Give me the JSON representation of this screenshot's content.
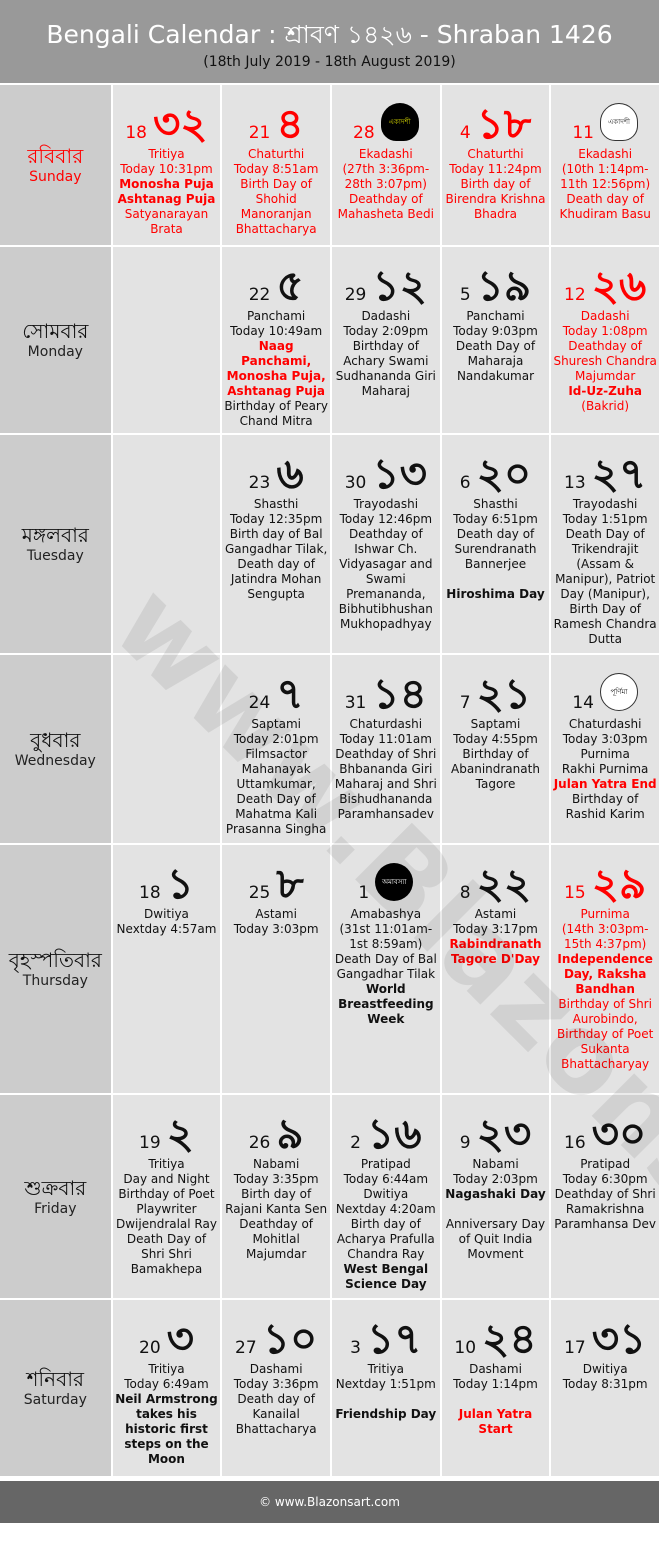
{
  "header": {
    "title": "Bengali Calendar : শ্রাবণ ১৪২৬ - Shraban 1426",
    "subtitle": "(18th July 2019 - 18th August 2019)"
  },
  "watermark": "www.Blazonsart.com",
  "footer": {
    "text": "© www.Blazonsart.com"
  },
  "colors": {
    "header_bg": "#999999",
    "day_bg": "#cccccc",
    "cell_bg": "#e3e3e3",
    "holiday_red": "#ff0000",
    "footer_bg": "#666666"
  },
  "rows": [
    {
      "day_bn": "রবিবার",
      "day_en": "Sunday",
      "holiday": true,
      "cells": [
        {
          "eng": "18",
          "bng": "৩২",
          "red": true,
          "lines": [
            {
              "t": "Tritiya"
            },
            {
              "t": "Today 10:31pm"
            },
            {
              "t": "Monosha Puja",
              "b": true
            },
            {
              "t": "Ashtanag Puja",
              "b": true
            },
            {
              "t": "Satyanarayan Brata"
            }
          ]
        },
        {
          "eng": "21",
          "bng": "৪",
          "red": true,
          "lines": [
            {
              "t": "Chaturthi"
            },
            {
              "t": "Today 8:51am"
            },
            {
              "t": "Birth Day of Shohid Manoranjan Bhattacharya"
            }
          ]
        },
        {
          "eng": "28",
          "moon": "crescent-dark",
          "moon_label": "একাদশী",
          "red": true,
          "lines": [
            {
              "t": "Ekadashi"
            },
            {
              "t": "(27th 3:36pm-28th 3:07pm)"
            },
            {
              "t": "Deathday of Mahasheta Bedi"
            }
          ]
        },
        {
          "eng": "4",
          "bng": "১৮",
          "red": true,
          "lines": [
            {
              "t": "Chaturthi"
            },
            {
              "t": "Today 11:24pm"
            },
            {
              "t": "Birth day of Birendra Krishna Bhadra"
            }
          ]
        },
        {
          "eng": "11",
          "moon": "crescent-light",
          "moon_label": "একাদশী",
          "red": true,
          "lines": [
            {
              "t": "Ekadashi"
            },
            {
              "t": "(10th 1:14pm-11th 12:56pm)"
            },
            {
              "t": "Death day of Khudiram Basu"
            }
          ]
        }
      ]
    },
    {
      "day_bn": "সোমবার",
      "day_en": "Monday",
      "cells": [
        null,
        {
          "eng": "22",
          "bng": "৫",
          "lines": [
            {
              "t": "Panchami"
            },
            {
              "t": "Today 10:49am"
            },
            {
              "t": "Naag Panchami, Monosha Puja, Ashtanag Puja",
              "b": true,
              "r": true
            },
            {
              "t": "Birthday of Peary Chand Mitra"
            }
          ]
        },
        {
          "eng": "29",
          "bng": "১২",
          "lines": [
            {
              "t": "Dadashi"
            },
            {
              "t": "Today 2:09pm"
            },
            {
              "t": "Birthday of Achary Swami Sudhananda Giri Maharaj"
            }
          ]
        },
        {
          "eng": "5",
          "bng": "১৯",
          "lines": [
            {
              "t": "Panchami"
            },
            {
              "t": "Today 9:03pm"
            },
            {
              "t": "Death Day of Maharaja Nandakumar"
            }
          ]
        },
        {
          "eng": "12",
          "bng": "২৬",
          "red": true,
          "lines": [
            {
              "t": "Dadashi"
            },
            {
              "t": "Today 1:08pm"
            },
            {
              "t": "Deathday of Shuresh Chandra Majumdar"
            },
            {
              "t": "Id-Uz-Zuha",
              "b": true
            },
            {
              "t": "(Bakrid)"
            }
          ]
        }
      ]
    },
    {
      "day_bn": "মঙ্গলবার",
      "day_en": "Tuesday",
      "cells": [
        null,
        {
          "eng": "23",
          "bng": "৬",
          "lines": [
            {
              "t": "Shasthi"
            },
            {
              "t": "Today 12:35pm"
            },
            {
              "t": "Birth day of Bal Gangadhar Tilak, Death day of Jatindra Mohan Sengupta"
            }
          ]
        },
        {
          "eng": "30",
          "bng": "১৩",
          "lines": [
            {
              "t": "Trayodashi"
            },
            {
              "t": "Today 12:46pm"
            },
            {
              "t": "Deathday of Ishwar Ch. Vidyasagar and Swami Premananda, Bibhutibhushan Mukhopadhyay"
            }
          ]
        },
        {
          "eng": "6",
          "bng": "২০",
          "lines": [
            {
              "t": "Shasthi"
            },
            {
              "t": "Today 6:51pm"
            },
            {
              "t": "Death day of Surendranath Bannerjee"
            },
            {
              "gap": true
            },
            {
              "t": "Hiroshima Day",
              "b": true
            }
          ]
        },
        {
          "eng": "13",
          "bng": "২৭",
          "lines": [
            {
              "t": "Trayodashi"
            },
            {
              "t": "Today 1:51pm"
            },
            {
              "t": "Death Day of Trikendrajit (Assam & Manipur), Patriot Day (Manipur), Birth Day of Ramesh Chandra Dutta"
            }
          ]
        }
      ]
    },
    {
      "day_bn": "বুধবার",
      "day_en": "Wednesday",
      "cells": [
        null,
        {
          "eng": "24",
          "bng": "৭",
          "lines": [
            {
              "t": "Saptami"
            },
            {
              "t": "Today 2:01pm"
            },
            {
              "t": "Filmsactor Mahanayak Uttamkumar, Death Day of Mahatma Kali Prasanna Singha"
            }
          ]
        },
        {
          "eng": "31",
          "bng": "১৪",
          "lines": [
            {
              "t": "Chaturdashi"
            },
            {
              "t": "Today 11:01am"
            },
            {
              "t": "Deathday of Shri Bhbananda Giri Maharaj and Shri Bishudhananda Paramhansadev"
            }
          ]
        },
        {
          "eng": "7",
          "bng": "২১",
          "lines": [
            {
              "t": "Saptami"
            },
            {
              "t": "Today 4:55pm"
            },
            {
              "t": "Birthday of Abanindranath Tagore"
            }
          ]
        },
        {
          "eng": "14",
          "moon": "full",
          "moon_label": "পূর্ণিমা",
          "lines": [
            {
              "t": "Chaturdashi"
            },
            {
              "t": "Today 3:03pm"
            },
            {
              "t": "Purnima"
            },
            {
              "t": "Rakhi Purnima"
            },
            {
              "t": "Julan Yatra End",
              "b": true,
              "r": true
            },
            {
              "t": "Birthday of Rashid Karim"
            }
          ]
        }
      ]
    },
    {
      "day_bn": "বৃহস্পতিবার",
      "day_en": "Thursday",
      "cells": [
        {
          "eng": "18",
          "bng": "১",
          "lines": [
            {
              "t": "Dwitiya"
            },
            {
              "t": "Nextday 4:57am"
            }
          ]
        },
        {
          "eng": "25",
          "bng": "৮",
          "lines": [
            {
              "t": "Astami"
            },
            {
              "t": "Today 3:03pm"
            }
          ]
        },
        {
          "eng": "1",
          "moon": "new",
          "moon_label": "অমাবস্যা",
          "lines": [
            {
              "t": "Amabashya"
            },
            {
              "t": "(31st 11:01am-1st 8:59am)"
            },
            {
              "t": "Death Day of Bal Gangadhar Tilak"
            },
            {
              "t": "World Breastfeeding Week",
              "b": true
            }
          ]
        },
        {
          "eng": "8",
          "bng": "২২",
          "lines": [
            {
              "t": "Astami"
            },
            {
              "t": "Today 3:17pm"
            },
            {
              "t": "Rabindranath Tagore D'Day",
              "b": true,
              "r": true
            }
          ]
        },
        {
          "eng": "15",
          "bng": "২৯",
          "red": true,
          "lines": [
            {
              "t": "Purnima"
            },
            {
              "t": "(14th 3:03pm-15th 4:37pm)"
            },
            {
              "t": "Independence Day, Raksha Bandhan",
              "b": true
            },
            {
              "t": "Birthday of Shri Aurobindo, Birthday of Poet Sukanta Bhattacharyay"
            }
          ]
        }
      ]
    },
    {
      "day_bn": "শুক্রবার",
      "day_en": "Friday",
      "cells": [
        {
          "eng": "19",
          "bng": "২",
          "lines": [
            {
              "t": "Tritiya"
            },
            {
              "t": "Day and Night"
            },
            {
              "t": "Birthday of Poet Playwriter Dwijendralal Ray"
            },
            {
              "t": "Death Day of Shri Shri Bamakhepa"
            }
          ]
        },
        {
          "eng": "26",
          "bng": "৯",
          "lines": [
            {
              "t": "Nabami"
            },
            {
              "t": "Today 3:35pm"
            },
            {
              "t": "Birth day of Rajani Kanta Sen"
            },
            {
              "t": "Deathday of Mohitlal Majumdar"
            }
          ]
        },
        {
          "eng": "2",
          "bng": "১৬",
          "lines": [
            {
              "t": "Pratipad"
            },
            {
              "t": "Today 6:44am"
            },
            {
              "t": "Dwitiya"
            },
            {
              "t": "Nextday 4:20am"
            },
            {
              "t": "Birth day of Acharya Prafulla Chandra Ray"
            },
            {
              "t": "West Bengal Science Day",
              "b": true
            }
          ]
        },
        {
          "eng": "9",
          "bng": "২৩",
          "lines": [
            {
              "t": "Nabami"
            },
            {
              "t": "Today 2:03pm"
            },
            {
              "t": "Nagashaki Day",
              "b": true
            },
            {
              "gap": true
            },
            {
              "t": "Anniversary Day of Quit India Movment"
            }
          ]
        },
        {
          "eng": "16",
          "bng": "৩০",
          "lines": [
            {
              "t": "Pratipad"
            },
            {
              "t": "Today 6:30pm"
            },
            {
              "t": "Deathday of Shri Ramakrishna Paramhansa Dev"
            }
          ]
        }
      ]
    },
    {
      "day_bn": "শনিবার",
      "day_en": "Saturday",
      "cells": [
        {
          "eng": "20",
          "bng": "৩",
          "lines": [
            {
              "t": "Tritiya"
            },
            {
              "t": "Today 6:49am"
            },
            {
              "t": "Neil Armstrong takes his historic first steps on the Moon",
              "b": true
            }
          ]
        },
        {
          "eng": "27",
          "bng": "১০",
          "lines": [
            {
              "t": "Dashami"
            },
            {
              "t": "Today 3:36pm"
            },
            {
              "t": "Death day of Kanailal Bhattacharya"
            }
          ]
        },
        {
          "eng": "3",
          "bng": "১৭",
          "lines": [
            {
              "t": "Tritiya"
            },
            {
              "t": "Nextday 1:51pm"
            },
            {
              "gap": true
            },
            {
              "t": "Friendship Day",
              "b": true
            }
          ]
        },
        {
          "eng": "10",
          "bng": "২৪",
          "lines": [
            {
              "t": "Dashami"
            },
            {
              "t": "Today 1:14pm"
            },
            {
              "gap": true
            },
            {
              "t": "Julan Yatra Start",
              "b": true,
              "r": true
            }
          ]
        },
        {
          "eng": "17",
          "bng": "৩১",
          "lines": [
            {
              "t": "Dwitiya"
            },
            {
              "t": "Today 8:31pm"
            }
          ]
        }
      ]
    }
  ]
}
